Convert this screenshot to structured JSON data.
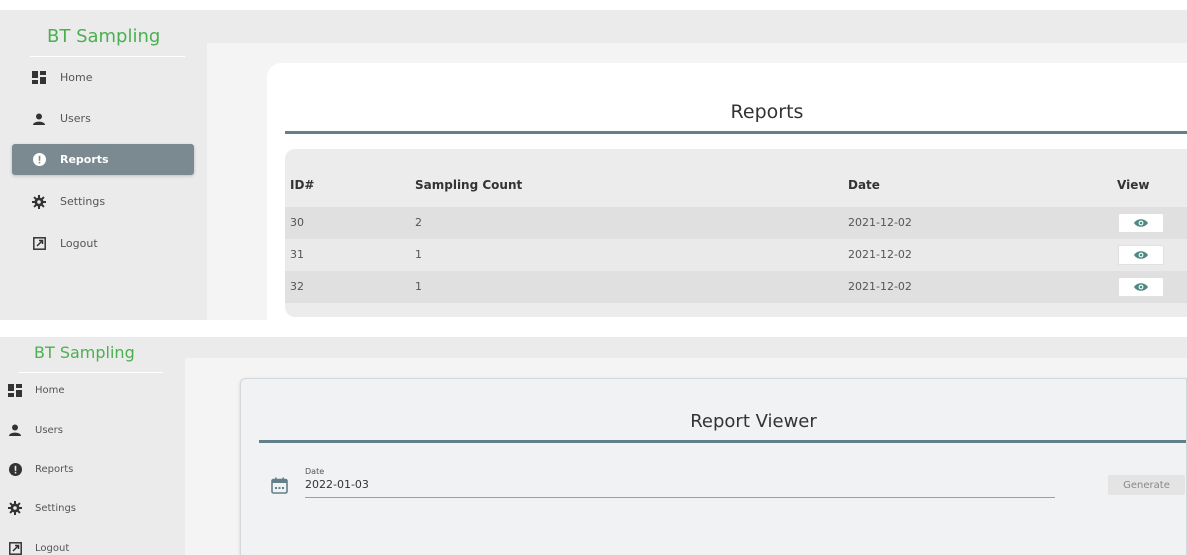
{
  "reports_screen": {
    "brand": "BT Sampling",
    "nav": [
      {
        "label": "Home",
        "icon": "dashboard-icon"
      },
      {
        "label": "Users",
        "icon": "user-icon"
      },
      {
        "label": "Reports",
        "icon": "alert-icon",
        "active": true
      },
      {
        "label": "Settings",
        "icon": "gear-icon"
      },
      {
        "label": "Logout",
        "icon": "logout-icon"
      }
    ],
    "title": "Reports",
    "table": {
      "headers": [
        "ID#",
        "Sampling Count",
        "Date",
        "View"
      ],
      "rows": [
        {
          "id": "30",
          "count": "2",
          "date": "2021-12-02"
        },
        {
          "id": "31",
          "count": "1",
          "date": "2021-12-02"
        },
        {
          "id": "32",
          "count": "1",
          "date": "2021-12-02"
        }
      ]
    }
  },
  "viewer_screen": {
    "brand": "BT Sampling",
    "nav": [
      {
        "label": "Home",
        "icon": "dashboard-icon"
      },
      {
        "label": "Users",
        "icon": "user-icon"
      },
      {
        "label": "Reports",
        "icon": "alert-icon"
      },
      {
        "label": "Settings",
        "icon": "gear-icon"
      },
      {
        "label": "Logout",
        "icon": "logout-icon"
      }
    ],
    "title": "Report Viewer",
    "date_field": {
      "label": "Date",
      "value": "2022-01-03"
    },
    "generate_label": "Generate"
  },
  "colors": {
    "brand": "#4caf50",
    "accent_rule": "#627f8a",
    "active_nav": "#7b8a91",
    "eye_icon": "#4a8a82"
  }
}
